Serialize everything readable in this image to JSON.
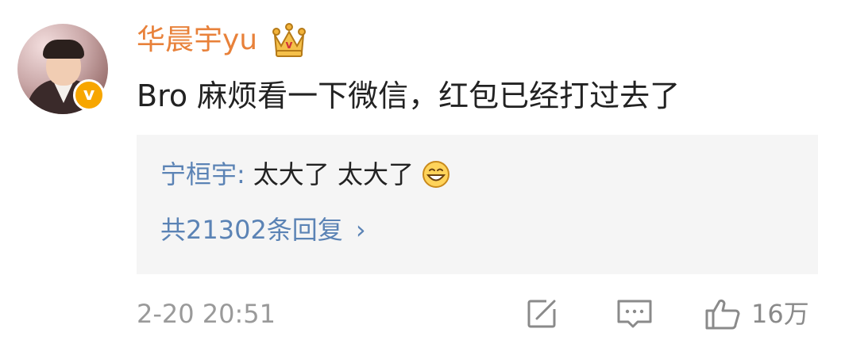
{
  "comment": {
    "username": "华晨宇yu",
    "avatar_badge": "v",
    "crown_icon": "crown-icon",
    "text": "Bro 麻烦看一下微信，红包已经打过去了",
    "timestamp": "2-20 20:51",
    "likes": "16万"
  },
  "reply": {
    "author": "宁桓宇",
    "colon": ":",
    "text": "太大了 太大了",
    "emoji_icon": "grin-emoji-icon",
    "more_label": "共21302条回复",
    "chevron": "›"
  },
  "actions": {
    "share_icon": "share-icon",
    "comment_icon": "comment-icon",
    "like_icon": "thumbs-up-icon"
  },
  "colors": {
    "username": "#e8813a",
    "link": "#5b83b5",
    "meta": "#9a9a9a",
    "reply_bg": "#f5f5f5",
    "badge": "#f7a600"
  }
}
